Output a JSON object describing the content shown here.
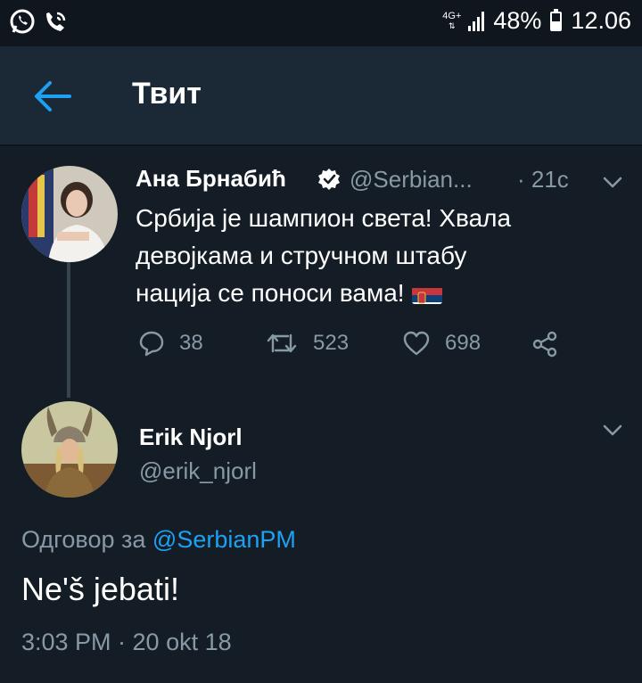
{
  "status_bar": {
    "network": "4G+",
    "battery": "48%",
    "battery_level": 0.48,
    "time": "12.06",
    "left_icons": [
      "whatsapp-icon",
      "phone-wifi-icon"
    ]
  },
  "header": {
    "back_icon": "arrow-left-icon",
    "title": "Твит"
  },
  "tweet": {
    "name": "Ана Брнабић",
    "handle": "@Serbian...",
    "time": "· 21с",
    "lines": [
      "Србија је шампион света! Хвала",
      "девојкама и стручном штабу",
      "нација се поноси вама!"
    ],
    "flag": "serbia-flag-emoji",
    "replies": "38",
    "retweets": "523",
    "likes": "698"
  },
  "reply": {
    "name": "Erik Njorl",
    "handle": "@erik_njorl",
    "reply_prefix": "Одговор за",
    "reply_mention": "@SerbianPM",
    "text": "Ne'š jebati!",
    "meta": "3:03 PM · 20 okt 18"
  },
  "colors": {
    "background": "#141d26",
    "header": "#1b2836",
    "secondary_text": "#8899a6",
    "accent": "#1da1f2"
  }
}
